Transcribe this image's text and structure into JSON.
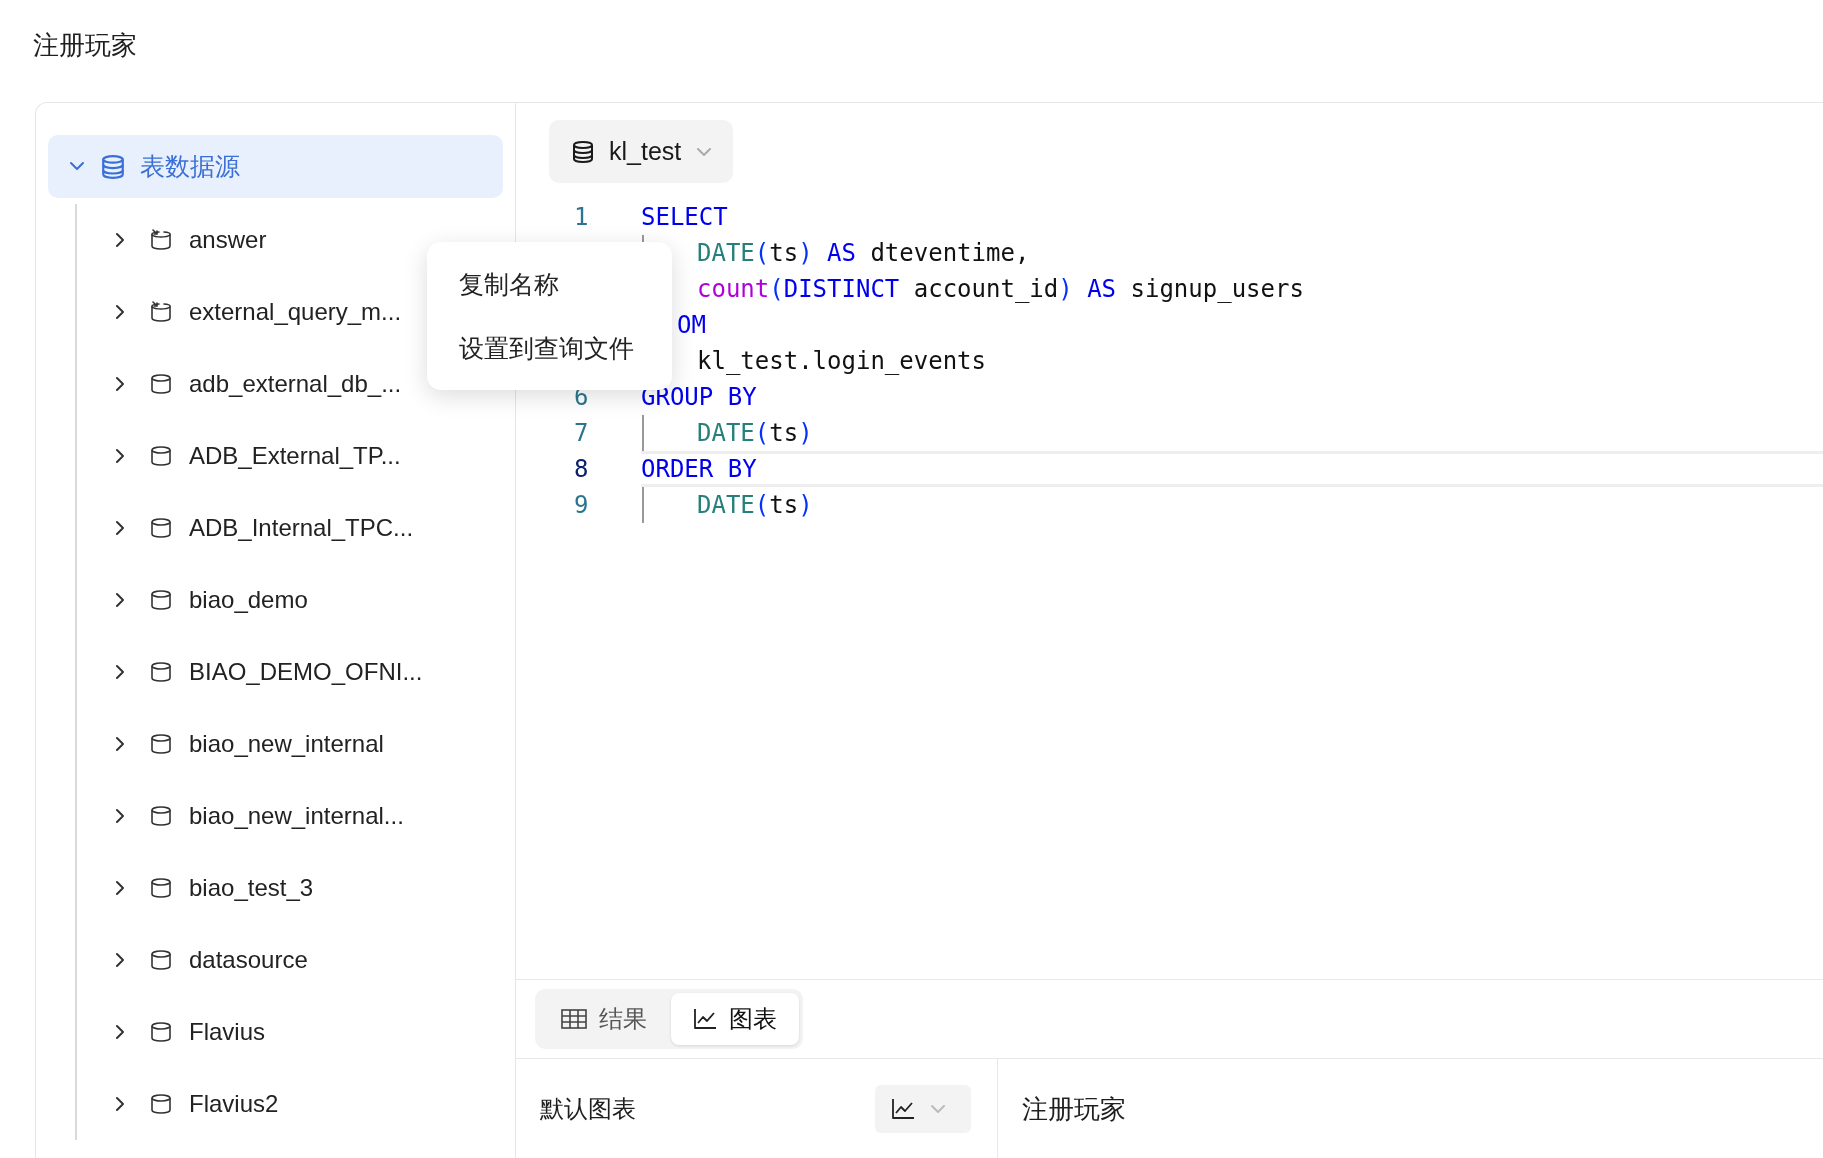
{
  "page_title": "注册玩家",
  "tree": {
    "root": {
      "label": "表数据源",
      "expanded": true,
      "selected": true,
      "children": [
        {
          "label": "answer",
          "kind": "query",
          "expanded": false
        },
        {
          "label": "external_query_m...",
          "kind": "query",
          "expanded": false
        },
        {
          "label": "adb_external_db_...",
          "kind": "database",
          "expanded": false
        },
        {
          "label": "ADB_External_TP...",
          "kind": "database",
          "expanded": false
        },
        {
          "label": "ADB_Internal_TPC...",
          "kind": "database",
          "expanded": false
        },
        {
          "label": "biao_demo",
          "kind": "database",
          "expanded": false
        },
        {
          "label": "BIAO_DEMO_OFNI...",
          "kind": "database",
          "expanded": false
        },
        {
          "label": "biao_new_internal",
          "kind": "database",
          "expanded": false
        },
        {
          "label": "biao_new_internal...",
          "kind": "database",
          "expanded": false
        },
        {
          "label": "biao_test_3",
          "kind": "database",
          "expanded": false
        },
        {
          "label": "datasource",
          "kind": "database",
          "expanded": false
        },
        {
          "label": "Flavius",
          "kind": "database",
          "expanded": false
        },
        {
          "label": "Flavius2",
          "kind": "database",
          "expanded": false
        }
      ]
    }
  },
  "context_menu": {
    "items": [
      "复制名称",
      "设置到查询文件"
    ]
  },
  "database_select": {
    "value": "kl_test"
  },
  "editor": {
    "lines": [
      {
        "number": "1",
        "current": false,
        "indented": false,
        "tokens": [
          {
            "text": "SELECT",
            "kind": "keyword"
          }
        ]
      },
      {
        "current": false,
        "indented": true,
        "tokens": [
          {
            "text": "DATE",
            "kind": "function"
          },
          {
            "text": "(",
            "kind": "punct"
          },
          {
            "text": "ts",
            "kind": "plain"
          },
          {
            "text": ")",
            "kind": "punct"
          },
          {
            "text": " AS",
            "kind": "keyword"
          },
          {
            "text": " dteventime,",
            "kind": "plain"
          }
        ]
      },
      {
        "current": false,
        "indented": true,
        "tokens": [
          {
            "text": "count",
            "kind": "builtin"
          },
          {
            "text": "(",
            "kind": "punct"
          },
          {
            "text": "DISTINCT",
            "kind": "keyword"
          },
          {
            "text": " account_id",
            "kind": "plain"
          },
          {
            "text": ")",
            "kind": "punct"
          },
          {
            "text": " AS",
            "kind": "keyword"
          },
          {
            "text": " signup_users",
            "kind": "plain"
          }
        ]
      },
      {
        "current": false,
        "indented": false,
        "covered": true,
        "tokens": [
          {
            "text": "OM",
            "kind": "keyword"
          }
        ]
      },
      {
        "current": false,
        "indented": true,
        "tokens": [
          {
            "text": "kl_test.login_events",
            "kind": "plain"
          }
        ]
      },
      {
        "number": "6",
        "current": false,
        "indented": false,
        "tokens": [
          {
            "text": "GROUP BY",
            "kind": "keyword"
          }
        ]
      },
      {
        "number": "7",
        "current": false,
        "indented": true,
        "tokens": [
          {
            "text": "DATE",
            "kind": "function"
          },
          {
            "text": "(",
            "kind": "punct"
          },
          {
            "text": "ts",
            "kind": "plain"
          },
          {
            "text": ")",
            "kind": "punct"
          }
        ]
      },
      {
        "number": "8",
        "current": true,
        "indented": false,
        "tokens": [
          {
            "text": "ORDER BY",
            "kind": "keyword"
          }
        ]
      },
      {
        "number": "9",
        "current": false,
        "indented": true,
        "tokens": [
          {
            "text": "DATE",
            "kind": "function"
          },
          {
            "text": "(",
            "kind": "punct"
          },
          {
            "text": "ts",
            "kind": "plain"
          },
          {
            "text": ")",
            "kind": "punct"
          }
        ]
      }
    ]
  },
  "result_tabs": [
    {
      "label": "结果",
      "selected": false
    },
    {
      "label": "图表",
      "selected": true
    }
  ],
  "chart_settings": {
    "label": "默认图表"
  },
  "chart_title": "注册玩家"
}
